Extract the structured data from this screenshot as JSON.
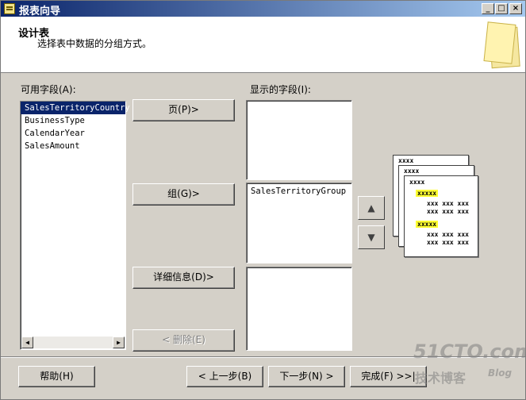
{
  "window": {
    "title": "报表向导"
  },
  "header": {
    "title": "设计表",
    "subtitle": "选择表中数据的分组方式。"
  },
  "available": {
    "label": "可用字段(A):",
    "items": [
      "SalesTerritoryCountry",
      "BusinessType",
      "CalendarYear",
      "SalesAmount"
    ]
  },
  "displayed": {
    "label": "显示的字段(I):"
  },
  "buttons": {
    "page": "页(P)>",
    "group": "组(G)>",
    "details": "详细信息(D)>",
    "remove": "< 删除(E)"
  },
  "groups": {
    "items": [
      "SalesTerritoryGroup"
    ]
  },
  "preview": {
    "h1": "xxxx",
    "h2": "xxxx",
    "h3": "xxxx",
    "grp1": "xxxxx",
    "grp2": "xxxxx",
    "row": "xxx xxx xxx"
  },
  "footer": {
    "help": "帮助(H)",
    "back": "< 上一步(B)",
    "next": "下一步(N) >",
    "finish": "完成(F) >>|"
  },
  "watermark": {
    "line1": "51CTO.com",
    "line2": "技术博客",
    "line3": "Blog"
  }
}
